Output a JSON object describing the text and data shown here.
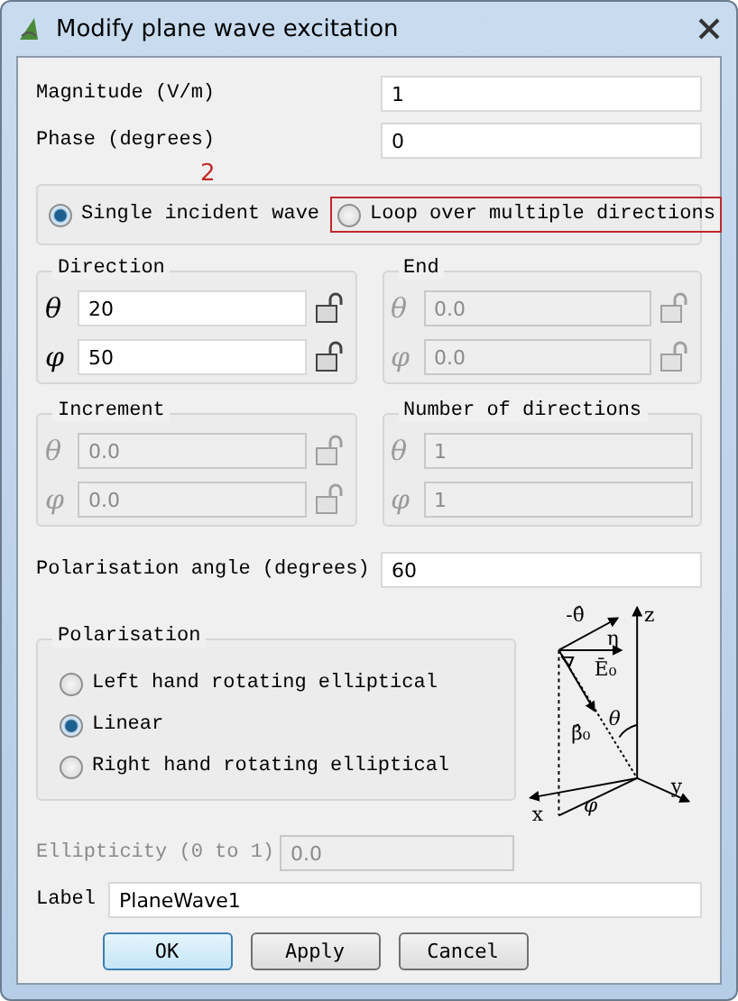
{
  "window": {
    "title": "Modify plane wave excitation"
  },
  "fields": [
    {
      "label": "Magnitude (V/m)",
      "value": "1"
    },
    {
      "label": "Phase (degrees)",
      "value": "0"
    }
  ],
  "mode": {
    "options": [
      {
        "label": "Single incident wave",
        "selected": true,
        "annotated": false
      },
      {
        "label": "Loop over multiple directions",
        "selected": false,
        "annotated": true
      }
    ],
    "annotation": "2"
  },
  "groups": [
    {
      "title": "Direction",
      "lockable": true,
      "rows": [
        {
          "symbol": "θ",
          "value": "20",
          "disabled": false
        },
        {
          "symbol": "φ",
          "value": "50",
          "disabled": false
        }
      ]
    },
    {
      "title": "End",
      "lockable": true,
      "rows": [
        {
          "symbol": "θ",
          "value": "0.0",
          "disabled": true
        },
        {
          "symbol": "φ",
          "value": "0.0",
          "disabled": true
        }
      ]
    },
    {
      "title": "Increment",
      "lockable": true,
      "rows": [
        {
          "symbol": "θ",
          "value": "0.0",
          "disabled": true
        },
        {
          "symbol": "φ",
          "value": "0.0",
          "disabled": true
        }
      ]
    },
    {
      "title": "Number of directions",
      "lockable": false,
      "rows": [
        {
          "symbol": "θ",
          "value": "1",
          "disabled": true
        },
        {
          "symbol": "φ",
          "value": "1",
          "disabled": true
        }
      ]
    }
  ],
  "polarisation_angle": {
    "label": "Polarisation angle (degrees)",
    "value": "60"
  },
  "polarisation": {
    "title": "Polarisation",
    "options": [
      {
        "label": "Left hand rotating elliptical",
        "selected": false
      },
      {
        "label": "Linear",
        "selected": true
      },
      {
        "label": "Right hand rotating elliptical",
        "selected": false
      }
    ]
  },
  "diagram": {
    "theta_hat": "-θ̂",
    "z": "z",
    "eta": "η",
    "e0": "Ē₀",
    "theta": "θ",
    "beta": "β̂₀",
    "y": "y",
    "phi": "φ",
    "x": "x"
  },
  "ellipticity": {
    "label": "Ellipticity (0 to 1)",
    "value": "0.0",
    "disabled": true
  },
  "label_field": {
    "label": "Label",
    "value": "PlaneWave1"
  },
  "buttons": [
    {
      "label": "OK",
      "default": true
    },
    {
      "label": "Apply",
      "default": false
    },
    {
      "label": "Cancel",
      "default": false
    }
  ]
}
